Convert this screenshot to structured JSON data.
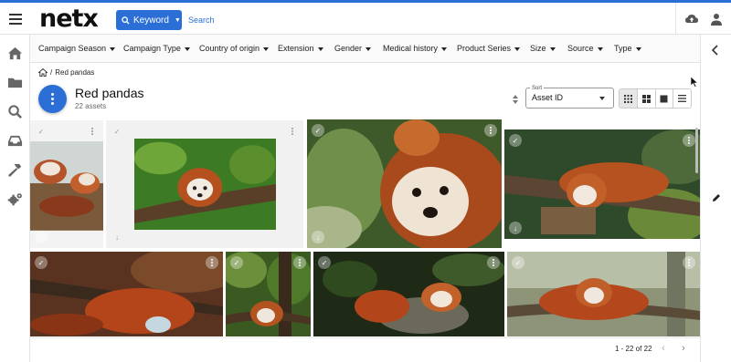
{
  "app": {
    "logo": "netx",
    "accent_color": "#2b6fd6"
  },
  "header": {
    "menu_icon": "hamburger-icon",
    "search_mode": "Keyword",
    "search_placeholder": "Search",
    "right_icons": [
      "cloud-upload-icon",
      "user-icon"
    ]
  },
  "left_rail": {
    "items": [
      "home-icon",
      "folder-icon",
      "search-icon",
      "inbox-icon",
      "hammer-icon",
      "gears-icon"
    ]
  },
  "right_rail": {
    "items": [
      "chevron-left-icon",
      "pencil-icon"
    ]
  },
  "filters": [
    "Campaign Season",
    "Campaign Type",
    "Country of origin",
    "Extension",
    "Gender",
    "Medical history",
    "Product Series",
    "Size",
    "Source",
    "Type"
  ],
  "breadcrumb": {
    "home_icon": "home-icon",
    "separator": "/",
    "current": "Red pandas"
  },
  "collection": {
    "title": "Red pandas",
    "count_text": "22 assets"
  },
  "sort": {
    "label": "Sort",
    "value": "Asset ID"
  },
  "view_modes": [
    {
      "icon": "grid-small-icon",
      "active": true
    },
    {
      "icon": "grid-medium-icon",
      "active": false
    },
    {
      "icon": "grid-large-icon",
      "active": false
    },
    {
      "icon": "list-icon",
      "active": false
    }
  ],
  "pagination": {
    "range_text": "1 - 22 of 22"
  }
}
